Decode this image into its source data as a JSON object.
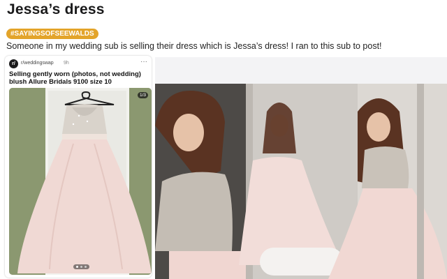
{
  "post": {
    "title": "Jessa’s dress",
    "flair": "#SAYINGSOFSEEWALDS",
    "body": "Someone in my wedding sub is selling their dress which is Jessa’s dress! I ran to this sub to post!"
  },
  "crosspost": {
    "subreddit_icon": "r/",
    "subreddit": "r/weddingswap",
    "time": "9h",
    "more_icon": "···",
    "title": "Selling gently worn (photos, not wedding) blush Allure Bridals 9100 size 10",
    "image_counter": "1/3",
    "carousel_dots": 3,
    "carousel_active": 0
  },
  "icons": {
    "more": "ellipsis-icon",
    "avatar": "subreddit-avatar-icon"
  },
  "colors": {
    "flair": "#e3a42a",
    "title": "#1a1a1b",
    "dress_blush": "#efd7d3"
  }
}
